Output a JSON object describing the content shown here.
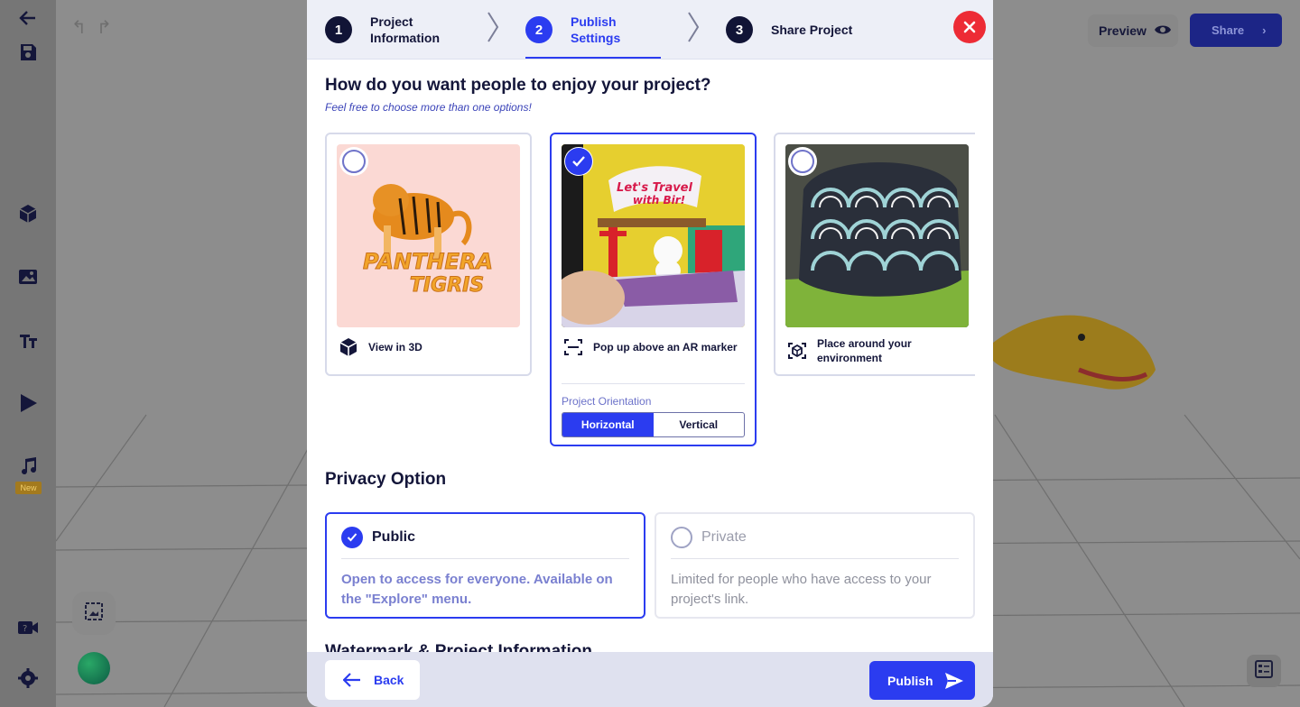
{
  "editor": {
    "preview_label": "Preview",
    "share_label": "Share",
    "new_badge": "New"
  },
  "stepper": {
    "steps": [
      {
        "number": "1",
        "label": "Project Information"
      },
      {
        "number": "2",
        "label": "Publish Settings"
      },
      {
        "number": "3",
        "label": "Share Project"
      }
    ],
    "active_step": 2
  },
  "experience": {
    "title": "How do you want people to enjoy your project?",
    "subtitle": "Feel free to choose more than one options!",
    "options": [
      {
        "label": "View in 3D",
        "icon": "cube-icon",
        "selected": false,
        "image_text": [
          "PANTHERA",
          "TIGRIS"
        ]
      },
      {
        "label": "Pop up above an AR marker",
        "icon": "ar-marker-icon",
        "selected": true,
        "image_text": [
          "Let's Travel",
          "with Bir!"
        ]
      },
      {
        "label": "Place around your environment",
        "icon": "place-3d-icon",
        "selected": false
      }
    ],
    "orientation": {
      "label": "Project Orientation",
      "options": [
        "Horizontal",
        "Vertical"
      ],
      "selected": "Horizontal"
    }
  },
  "privacy": {
    "title": "Privacy Option",
    "options": [
      {
        "label": "Public",
        "description": "Open to access for everyone. Available on the \"Explore\" menu.",
        "selected": true
      },
      {
        "label": "Private",
        "description": "Limited for people who have access to your project's link.",
        "selected": false
      }
    ]
  },
  "watermark": {
    "title": "Watermark & Project Information"
  },
  "footer": {
    "back_label": "Back",
    "publish_label": "Publish"
  },
  "colors": {
    "accent": "#2b3cf0",
    "close": "#ed2b35",
    "dark": "#14163a"
  }
}
